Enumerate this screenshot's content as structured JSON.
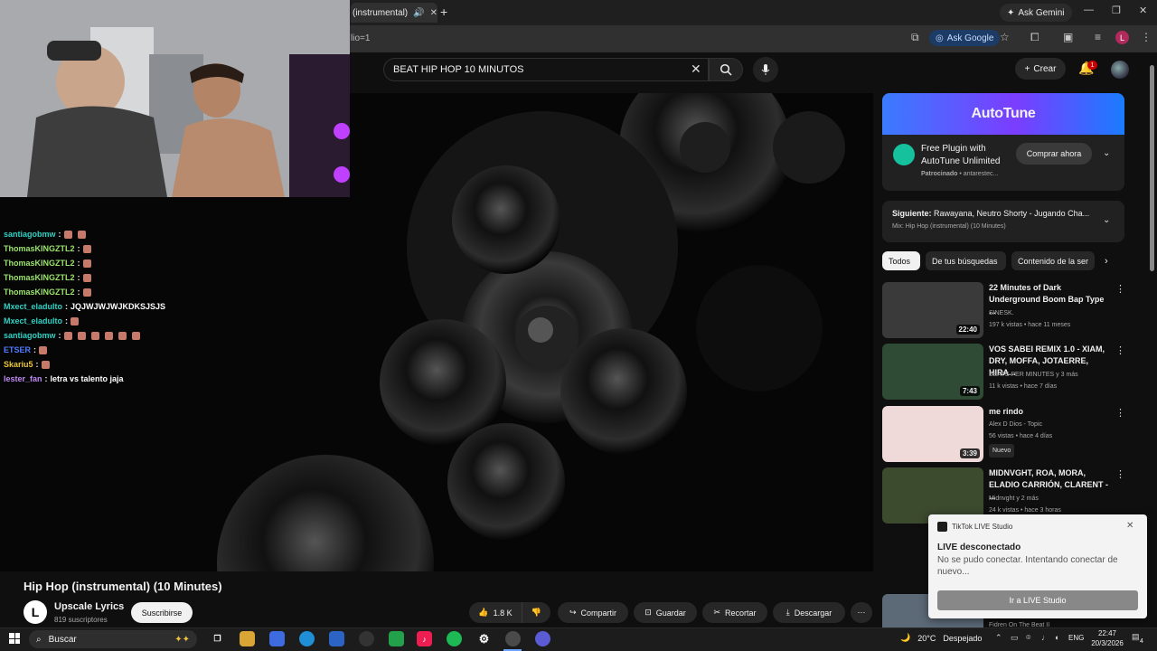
{
  "browser": {
    "tab_title": "(instrumental)",
    "tab_audio_icon": "speaker-icon",
    "url_fragment": "lio=1",
    "ask_gemini": "Ask Gemini",
    "ask_google": "Ask Google",
    "profile_initial": "L"
  },
  "youtube": {
    "search_query": "BEAT HIP HOP 10 MINUTOS",
    "create_label": "Crear",
    "notification_count": "1"
  },
  "chat": [
    {
      "user": "santiagobmw",
      "color": "#2ed1c4",
      "msg": "",
      "emotes": 2
    },
    {
      "user": "ThomasKINGZTL2",
      "color": "#9be36b",
      "msg": "",
      "emotes": 1
    },
    {
      "user": "ThomasKINGZTL2",
      "color": "#9be36b",
      "msg": "",
      "emotes": 1
    },
    {
      "user": "ThomasKINGZTL2",
      "color": "#9be36b",
      "msg": "",
      "emotes": 1
    },
    {
      "user": "ThomasKINGZTL2",
      "color": "#9be36b",
      "msg": "",
      "emotes": 1
    },
    {
      "user": "Mxect_eladulto",
      "color": "#2ed1c4",
      "msg": "JQJWJWJWJKDKSJSJS",
      "emotes": 0
    },
    {
      "user": "Mxect_eladulto",
      "color": "#2ed1c4",
      "msg": "",
      "emotes": 1
    },
    {
      "user": "santiagobmw",
      "color": "#2ed1c4",
      "msg": "",
      "emotes": 6
    },
    {
      "user": "ETSER",
      "color": "#4f7bff",
      "msg": "",
      "emotes": 1
    },
    {
      "user": "Skariu5",
      "color": "#e8c53a",
      "msg": "",
      "emotes": 1
    },
    {
      "user": "lester_fan",
      "color": "#c08af2",
      "msg": "letra vs talento jaja",
      "emotes": 0
    }
  ],
  "video": {
    "title": "Hip Hop (instrumental) (10 Minutes)",
    "channel": "Upscale Lyrics",
    "channel_initial": "L",
    "subscribers": "819 suscriptores",
    "subscribe": "Suscribirse",
    "likes": "1.8 K",
    "share": "Compartir",
    "save": "Guardar",
    "clip": "Recortar",
    "download": "Descargar"
  },
  "ad": {
    "banner": "AutoTune",
    "title": "Free Plugin with AutoTune Unlimited",
    "sponsored": "Patrocinado",
    "advertiser": "antarestec...",
    "cta": "Comprar ahora"
  },
  "next_up": {
    "label": "Siguiente:",
    "title": "Rawayana, Neutro Shorty - Jugando Cha...",
    "mix": "Mix: Hip Hop (instrumental) (10 Minutes)"
  },
  "chips": [
    "Todos",
    "De tus búsquedas",
    "Contenido de la ser"
  ],
  "recommendations": [
    {
      "title": "22 Minutes of Dark Underground Boom Bap Type ...",
      "channel": "SINESK.",
      "stats": "197 k vistas • hace 11 meses",
      "duration": "22:40",
      "thumb": "#3a3a3a",
      "badge": ""
    },
    {
      "title": "VOS SABEI REMIX 1.0 - XIAM, DRY, MOFFA, JOTAERRE, HIRA...",
      "channel": "BEATS PER MINUTES y 3 más",
      "stats": "11 k vistas • hace 7 días",
      "duration": "7:43",
      "thumb": "#2f4a35",
      "badge": ""
    },
    {
      "title": "me rindo",
      "channel": "Alex D Dios - Topic",
      "stats": "56 vistas • hace 4 días",
      "duration": "3:39",
      "thumb": "#f0d9d9",
      "badge": "Nuevo"
    },
    {
      "title": "MIDNVGHT, ROA, MORA, ELADIO CARRIÓN, CLARENT - ...",
      "channel": "Midnvght y 2 más",
      "stats": "24 k vistas • hace 3 horas",
      "duration": "",
      "thumb": "#3c4a2e",
      "badge": ""
    }
  ],
  "last_rec_channel": "Fidren On The Beat II",
  "notification": {
    "app": "TikTok LIVE Studio",
    "title": "LIVE desconectado",
    "body": "No se pudo conectar. Intentando conectar de nuevo...",
    "button": "Ir a LIVE Studio"
  },
  "taskbar": {
    "search": "Buscar",
    "temp": "20°C",
    "weather": "Despejado",
    "lang": "ENG",
    "time": "22:47",
    "date": "20/3/2026",
    "notif_count": "4"
  }
}
